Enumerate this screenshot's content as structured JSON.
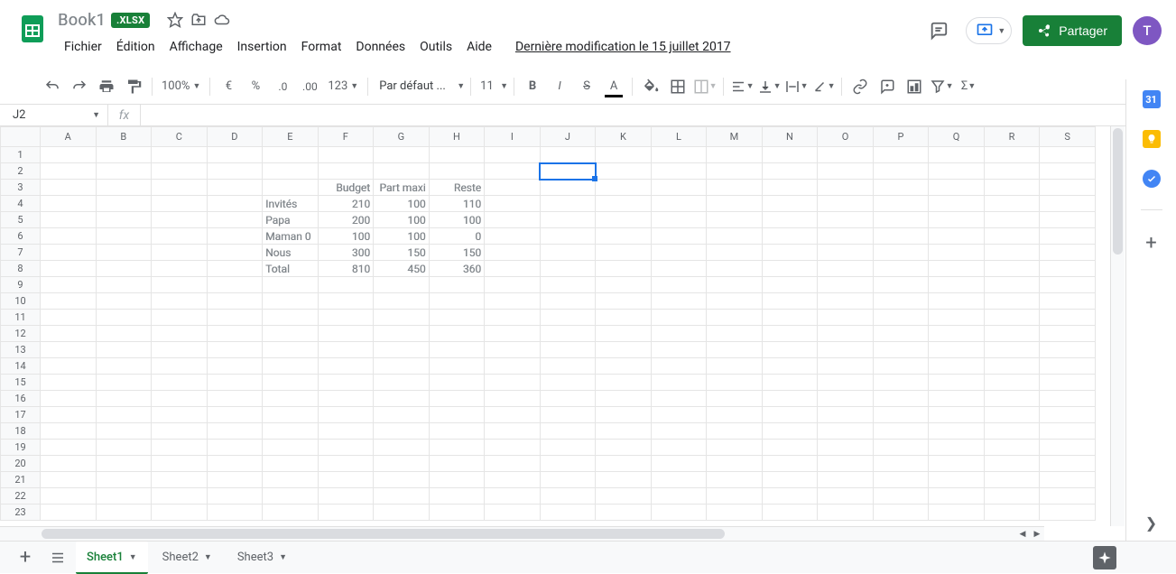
{
  "header": {
    "doc_title": "Book1",
    "chip": ".XLSX",
    "menus": [
      "Fichier",
      "Édition",
      "Affichage",
      "Insertion",
      "Format",
      "Données",
      "Outils",
      "Aide"
    ],
    "last_modified": "Dernière modification le 15 juillet 2017",
    "share_label": "Partager",
    "avatar_initial": "T"
  },
  "toolbar": {
    "zoom": "100%",
    "font_family": "Par défaut ...",
    "font_size": "11"
  },
  "namebox": {
    "ref": "J2"
  },
  "grid": {
    "columns": [
      "A",
      "B",
      "C",
      "D",
      "E",
      "F",
      "G",
      "H",
      "I",
      "J",
      "K",
      "L",
      "M",
      "N",
      "O",
      "P",
      "Q",
      "R",
      "S"
    ],
    "row_count": 23,
    "selected": {
      "row": 2,
      "col": "J"
    },
    "cells": {
      "F3": "Budget",
      "G3": "Part maxi",
      "H3": "Reste",
      "E4": "Invités",
      "F4": "210",
      "G4": "100",
      "H4": "110",
      "E5": "Papa",
      "F5": "200",
      "G5": "100",
      "H5": "100",
      "E6": "Maman 0",
      "F6": "100",
      "G6": "100",
      "H6": "0",
      "E7": "Nous",
      "F7": "300",
      "G7": "150",
      "H7": "150",
      "E8": "Total",
      "F8": "810",
      "G8": "450",
      "H8": "360"
    }
  },
  "sheets": {
    "tabs": [
      "Sheet1",
      "Sheet2",
      "Sheet3"
    ],
    "active": 0
  },
  "colors": {
    "brand_green": "#188038",
    "selection_blue": "#1a73e8"
  }
}
